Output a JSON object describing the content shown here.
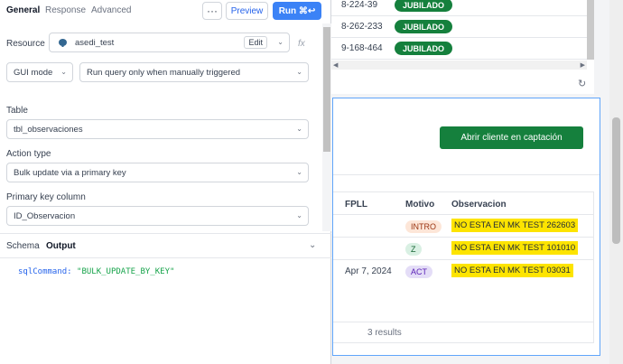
{
  "editor": {
    "tabs": [
      "General",
      "Response",
      "Advanced"
    ],
    "more_label": "···",
    "preview_label": "Preview",
    "run_label": "Run ⌘↩",
    "resource_label": "Resource",
    "resource_value": "asedi_test",
    "edit_label": "Edit",
    "fx_label": "fx",
    "mode_value": "GUI mode",
    "trigger_value": "Run query only when manually triggered",
    "table_label": "Table",
    "table_value": "tbl_observaciones",
    "action_label": "Action type",
    "action_value": "Bulk update via a primary key",
    "pk_label": "Primary key column",
    "pk_value": "ID_Observacion",
    "output_tabs": [
      "Schema",
      "Output"
    ],
    "sql_key": "sqlCommand:",
    "sql_value": "\"BULK_UPDATE_BY_KEY\""
  },
  "top_table": {
    "rows": [
      {
        "id": "8-224-39",
        "status": "JUBILADO"
      },
      {
        "id": "8-262-233",
        "status": "JUBILADO"
      },
      {
        "id": "9-168-464",
        "status": "JUBILADO"
      }
    ]
  },
  "canvas": {
    "button_label": "Abrir cliente en captación",
    "columns": [
      "FPLL",
      "Motivo",
      "Observacion"
    ],
    "rows": [
      {
        "fpll": "",
        "motivo": "INTRO",
        "obs": "NO ESTA EN MK TEST 262603"
      },
      {
        "fpll": "",
        "motivo": "Z",
        "obs": "NO ESTA EN MK TEST 101010"
      },
      {
        "fpll": "Apr 7, 2024",
        "motivo": "ACT",
        "obs": "NO ESTA EN MK TEST 03031"
      }
    ],
    "results": "3 results"
  },
  "colors": {
    "accent": "#3b82f6",
    "green": "#15803d",
    "highlight": "#fde400"
  }
}
